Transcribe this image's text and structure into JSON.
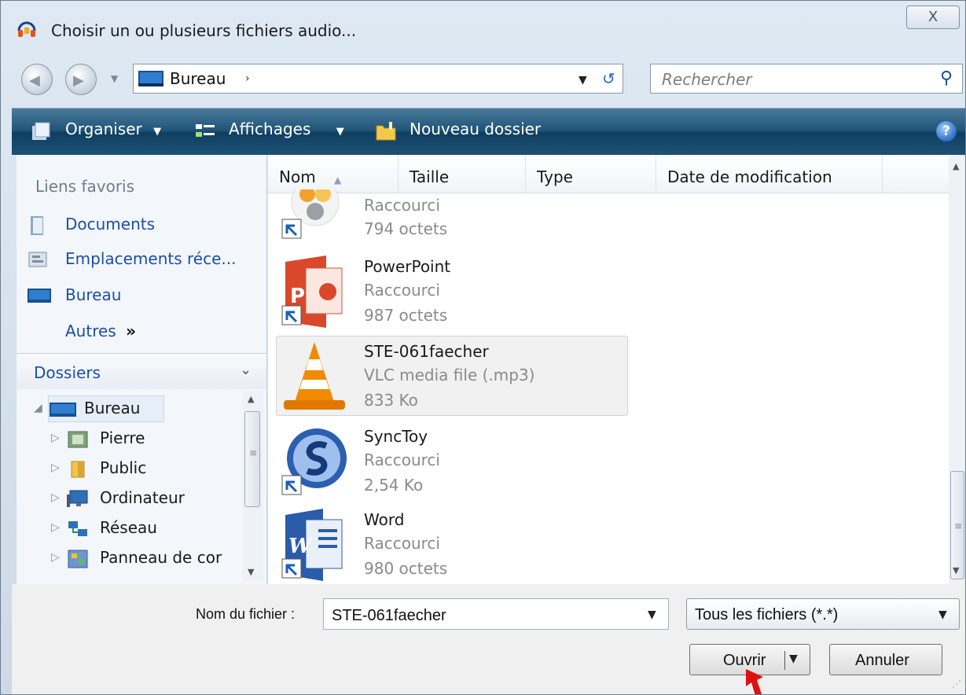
{
  "window": {
    "title": "Choisir un ou plusieurs fichiers audio...",
    "close_glyph": "X"
  },
  "nav": {
    "address": "Bureau",
    "address_chevron": "›",
    "search_placeholder": "Rechercher"
  },
  "toolbar": {
    "organize": "Organiser",
    "views": "Affichages",
    "new_folder": "Nouveau dossier",
    "help": "?"
  },
  "left": {
    "favorites_header": "Liens favoris",
    "favorites": [
      "Documents",
      "Emplacements réce...",
      "Bureau"
    ],
    "more": "Autres",
    "more_glyph": "»",
    "folders_header": "Dossiers",
    "tree": [
      "Bureau",
      "Pierre",
      "Public",
      "Ordinateur",
      "Réseau",
      "Panneau de cor"
    ]
  },
  "columns": [
    "Nom",
    "Taille",
    "Type",
    "Date de modification"
  ],
  "files": [
    {
      "name": "",
      "type": "Raccourci",
      "size": "794 octets",
      "icon": "shortcut-app-icon"
    },
    {
      "name": "PowerPoint",
      "type": "Raccourci",
      "size": "987 octets",
      "icon": "powerpoint-icon"
    },
    {
      "name": "STE-061faecher",
      "type": "VLC media file (.mp3)",
      "size": "833 Ko",
      "icon": "vlc-cone-icon",
      "selected": true
    },
    {
      "name": "SyncToy",
      "type": "Raccourci",
      "size": "2,54 Ko",
      "icon": "synctoy-icon"
    },
    {
      "name": "Word",
      "type": "Raccourci",
      "size": "980 octets",
      "icon": "word-icon"
    }
  ],
  "bottom": {
    "filename_label": "Nom du fichier :",
    "filename_value": "STE-061faecher",
    "filetype_value": "Tous les fichiers (*.*)",
    "open_label": "Ouvrir",
    "cancel_label": "Annuler"
  },
  "colors": {
    "toolbar": "#1f5477",
    "link": "#1c4ea6",
    "cursor": "#e01010"
  }
}
